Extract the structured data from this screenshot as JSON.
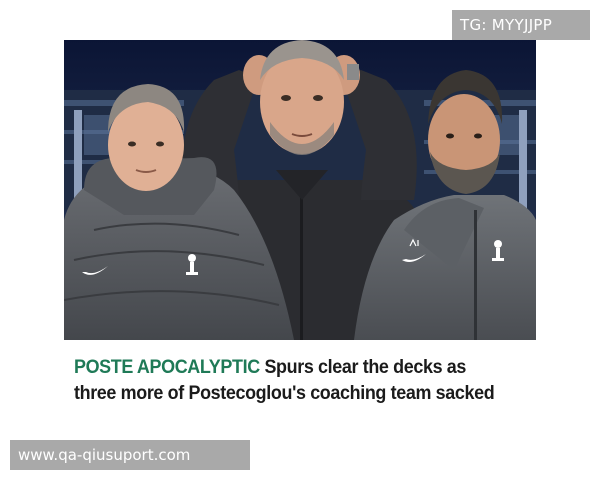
{
  "badge": {
    "text": "TG: MYYJJPP"
  },
  "article": {
    "kicker": "POSTE APOCALYPTIC",
    "headline": "Spurs clear the decks as three more of Postecoglou's coaching team sacked"
  },
  "watermark": {
    "text": "www.qa-qiusuport.com"
  },
  "photo": {
    "description_icon": "three-coaches-photo-icon",
    "colors": {
      "background_sky": "#0e1a3a",
      "stadium": "#2a3a55",
      "jacket_grey": "#5a5d63",
      "jacket_dark": "#2b2c30",
      "skin": "#d9a68a",
      "hair_grey": "#8a8580",
      "beard": "#5b5650"
    }
  },
  "colors": {
    "kicker_green": "#1f7a57",
    "headline_text": "#1b1b1b",
    "overlay_grey": "#a9a9a9"
  }
}
